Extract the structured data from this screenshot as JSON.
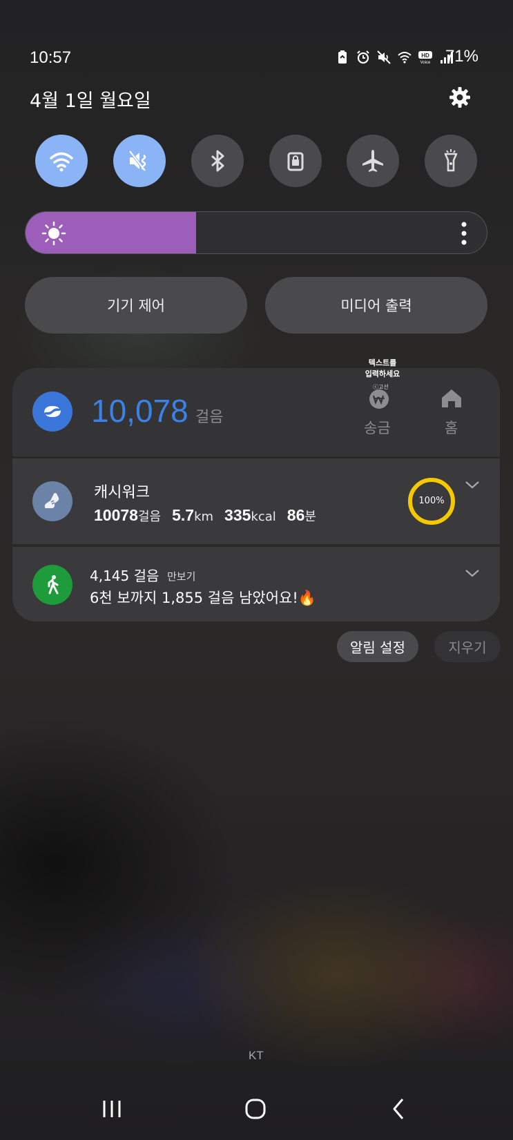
{
  "status_bar": {
    "time": "10:57",
    "battery": "71%",
    "icons": [
      "battery-saver-icon",
      "alarm-icon",
      "mute-icon",
      "wifi-icon",
      "hd-voice-icon",
      "signal-icon"
    ]
  },
  "date": "4월 1일 월요일",
  "quick_toggles": [
    {
      "name": "wifi",
      "on": true
    },
    {
      "name": "sound-mute",
      "on": true
    },
    {
      "name": "bluetooth",
      "on": false
    },
    {
      "name": "screen-lock",
      "on": false
    },
    {
      "name": "airplane-mode",
      "on": false
    },
    {
      "name": "flashlight",
      "on": false
    }
  ],
  "brightness": {
    "level": 0.37
  },
  "buttons": {
    "device_control": "기기 제어",
    "media_output": "미디어 출력"
  },
  "toss_card": {
    "steps": "10,078",
    "steps_unit": "걸음",
    "overlay_text": "텍스트를\n입력하세요",
    "overlay_small": "ⓒ고선",
    "send_label": "송금",
    "home_label": "홈"
  },
  "cashwalk": {
    "title": "캐시워크",
    "steps": "10078",
    "steps_unit": "걸음",
    "distance": "5.7",
    "distance_unit": "km",
    "calories": "335",
    "calories_unit": "kcal",
    "minutes": "86",
    "minutes_unit": "분",
    "progress_label": "100%",
    "progress": 1.0
  },
  "pedometer": {
    "steps": "4,145 걸음",
    "app": "만보기",
    "message": "6천 보까지 1,855 걸음 남았어요!🔥"
  },
  "notification_actions": {
    "settings": "알림 설정",
    "clear": "지우기"
  },
  "carrier": "KT",
  "colors": {
    "accent": "#8ab4f5",
    "brightness": "#9c5dbb",
    "steps": "#3b82e8",
    "ring": "#f5c800",
    "pedometer": "#1e9b3a"
  }
}
